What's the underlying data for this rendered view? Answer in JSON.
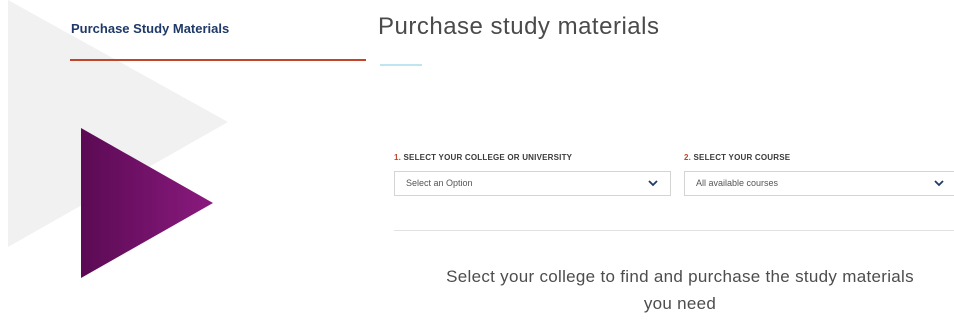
{
  "sidebar": {
    "title": "Purchase Study Materials"
  },
  "main": {
    "title": "Purchase study materials",
    "college_select": {
      "number": "1.",
      "label": "SELECT YOUR COLLEGE OR UNIVERSITY",
      "value": "Select an Option"
    },
    "course_select": {
      "number": "2.",
      "label": "SELECT YOUR COURSE",
      "value": "All available courses"
    },
    "prompt": "Select your college to find and purchase the study materials you need"
  },
  "colors": {
    "brand_purple": "#6d0f63",
    "accent_red": "#c0452a",
    "navy": "#1f3a68",
    "teal_rule": "#bfe6ef"
  }
}
